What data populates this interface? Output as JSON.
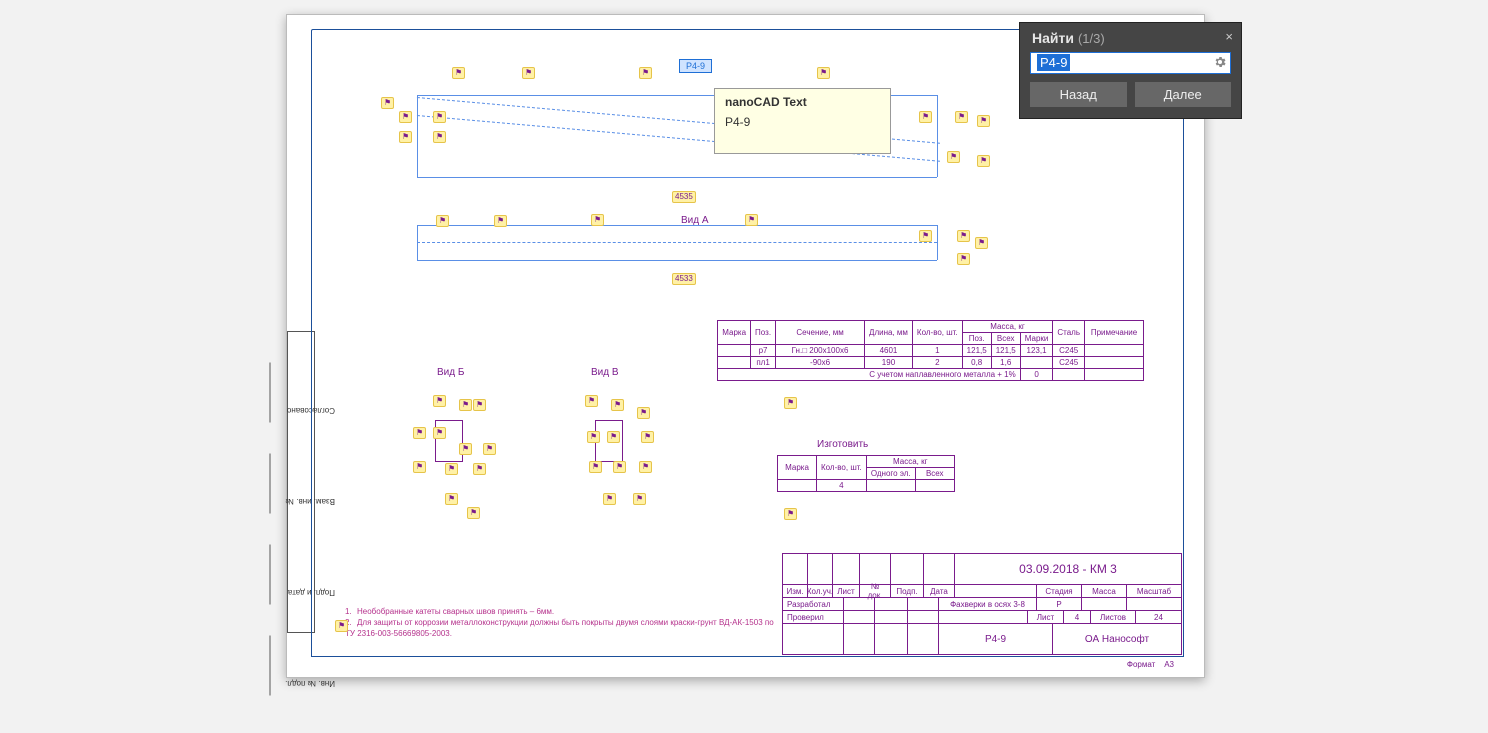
{
  "search": {
    "title": "Найти",
    "count": "(1/3)",
    "value": "P4-9",
    "prev": "Назад",
    "next": "Далее"
  },
  "tooltip": {
    "title": "nanoCAD Text",
    "value": "Р4-9"
  },
  "drawing": {
    "hit_label": "Р4-9",
    "dim1": "4535",
    "dim2": "4533",
    "view_label": "Вид А",
    "section_b": "Вид Б",
    "section_v": "Вид В"
  },
  "parts_table": {
    "headers": [
      "Марка",
      "Поз.",
      "Сечение, мм",
      "Длина, мм",
      "Кол-во, шт.",
      "Масса, кг",
      "",
      "",
      "Сталь",
      "Примечание"
    ],
    "sub_headers": [
      "Поз.",
      "Всех",
      "Марки"
    ],
    "rows": [
      [
        "",
        "р7",
        "Гн.□ 200х100х6",
        "4601",
        "1",
        "121,5",
        "121,5",
        "123,1",
        "С245",
        ""
      ],
      [
        "",
        "пл1",
        "-90х6",
        "190",
        "2",
        "0,8",
        "1,6",
        "",
        "С245",
        ""
      ]
    ],
    "summary_label": "С учетом наплавленного металла + 1%",
    "summary_blank": "0"
  },
  "make_table": {
    "title": "Изготовить",
    "headers": [
      "Марка",
      "Кол-во, шт.",
      "Масса, кг",
      ""
    ],
    "sub_headers": [
      "Одного эл.",
      "Всех"
    ],
    "row": [
      "",
      "4",
      "",
      ""
    ]
  },
  "sidebar_labels": [
    "Согласовано",
    "Взам. инв. №",
    "Подп. и дата",
    "Инв. № подл."
  ],
  "notes": {
    "n1": "Необобранные катеты сварных швов принять – 6мм.",
    "n2": "Для защиты от коррозии металлоконструкции должны быть покрыты двумя слоями краски-грунт ВД-АК-1503 по ТУ 2316-003-56669805-2003."
  },
  "titleblock": {
    "project": "03.09.2018 - КМ 3",
    "hdr": [
      "Изм.",
      "Кол.уч.",
      "Лист",
      "№ док.",
      "Подп.",
      "Дата"
    ],
    "dev": "Разработал",
    "chk": "Проверил",
    "obj": "Фахверки в осях 3-8",
    "stage_h": "Стадия",
    "mass_h": "Масса",
    "scale_h": "Масштаб",
    "stage": "Р",
    "sheet_h": "Лист",
    "sheet": "4",
    "sheets_h": "Листов",
    "sheets": "24",
    "docnum": "Р4-9",
    "company": "ОА Нанософт",
    "format_h": "Формат",
    "format": "А3"
  }
}
